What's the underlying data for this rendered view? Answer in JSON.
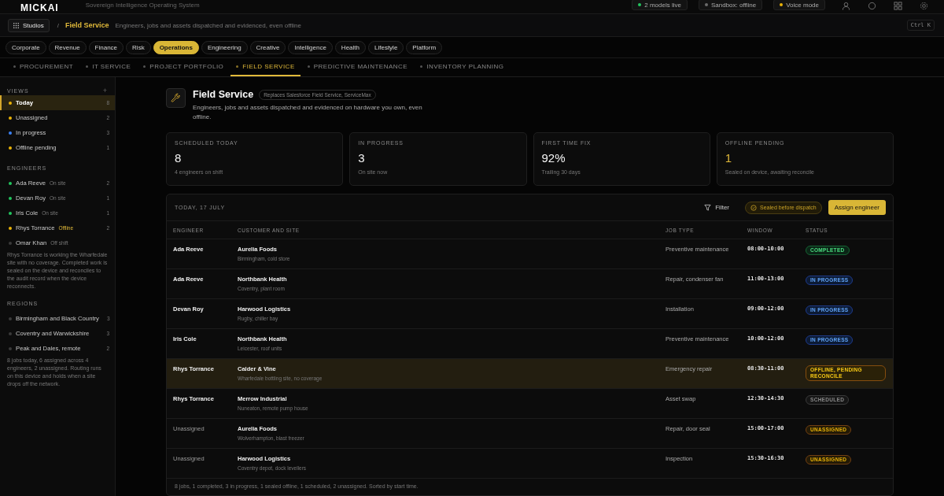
{
  "top_bar": {
    "logo": "MICKAI",
    "tagline": "Sovereign Intelligence Operating System",
    "pills": [
      {
        "label": "2 models live",
        "color": "#22c55e"
      },
      {
        "label": "Sandbox: offline",
        "color": "#6b6b6b"
      },
      {
        "label": "Voice mode",
        "color": "#eab308"
      }
    ]
  },
  "breadcrumb": {
    "studios": "Studios",
    "separator": "/",
    "current": "Field Service",
    "description": "Engineers, jobs and assets dispatched and evidenced, even offline",
    "shortcut": "Ctrl K"
  },
  "studios": [
    {
      "label": "Corporate",
      "selected": false
    },
    {
      "label": "Revenue",
      "selected": false
    },
    {
      "label": "Finance",
      "selected": false
    },
    {
      "label": "Risk",
      "selected": false
    },
    {
      "label": "Operations",
      "selected": true
    },
    {
      "label": "Engineering",
      "selected": false
    },
    {
      "label": "Creative",
      "selected": false
    },
    {
      "label": "Intelligence",
      "selected": false
    },
    {
      "label": "Health",
      "selected": false
    },
    {
      "label": "Lifestyle",
      "selected": false
    },
    {
      "label": "Platform",
      "selected": false
    }
  ],
  "tabs": [
    {
      "label": "PROCUREMENT",
      "selected": false
    },
    {
      "label": "IT SERVICE",
      "selected": false
    },
    {
      "label": "PROJECT PORTFOLIO",
      "selected": false
    },
    {
      "label": "FIELD SERVICE",
      "selected": true
    },
    {
      "label": "PREDICTIVE MAINTENANCE",
      "selected": false
    },
    {
      "label": "INVENTORY PLANNING",
      "selected": false
    }
  ],
  "sidebar": {
    "views_title": "VIEWS",
    "add": "+",
    "views": [
      {
        "label": "Today",
        "count": "8",
        "color": "#eab308",
        "selected": true
      },
      {
        "label": "Unassigned",
        "count": "2",
        "color": "#eab308",
        "selected": false
      },
      {
        "label": "In progress",
        "count": "3",
        "color": "#3b82f6",
        "selected": false
      },
      {
        "label": "Offline pending",
        "count": "1",
        "color": "#eab308",
        "selected": false
      }
    ],
    "engineers_title": "ENGINEERS",
    "engineers": [
      {
        "name": "Ada Reeve",
        "status": "On site",
        "count": "2",
        "color": "#22c55e",
        "offline": false
      },
      {
        "name": "Devan Roy",
        "status": "On site",
        "count": "1",
        "color": "#22c55e",
        "offline": false
      },
      {
        "name": "Iris Cole",
        "status": "On site",
        "count": "1",
        "color": "#22c55e",
        "offline": false
      },
      {
        "name": "Rhys Torrance",
        "status": "Offline",
        "count": "2",
        "color": "#eab308",
        "offline": true
      },
      {
        "name": "Omar Khan",
        "status": "Off shift",
        "color": "#3a3a3a",
        "offline": false
      }
    ],
    "engineers_note": "Rhys Torrance is working the Wharfedale site with no coverage. Completed work is sealed on the device and reconciles to the audit record when the device reconnects.",
    "regions_title": "REGIONS",
    "regions": [
      {
        "label": "Birmingham and Black Country",
        "count": "3"
      },
      {
        "label": "Coventry and Warwickshire",
        "count": "3"
      },
      {
        "label": "Peak and Dales, remote",
        "count": "2"
      }
    ],
    "regions_note": "8 jobs today, 6 assigned across 4 engineers, 2 unassigned. Routing runs on this device and holds when a site drops off the network."
  },
  "header": {
    "title": "Field Service",
    "badge": "Replaces Salesforce Field Service, ServiceMax",
    "description": "Engineers, jobs and assets dispatched and evidenced on hardware you own, even offline."
  },
  "stats": [
    {
      "label": "SCHEDULED TODAY",
      "value": "8",
      "note": "4 engineers on shift",
      "highlight": false
    },
    {
      "label": "IN PROGRESS",
      "value": "3",
      "note": "On site now",
      "highlight": false
    },
    {
      "label": "FIRST TIME FIX",
      "value": "92%",
      "note": "Trailing 30 days",
      "highlight": false
    },
    {
      "label": "OFFLINE PENDING",
      "value": "1",
      "note": "Sealed on device, awaiting reconcile",
      "highlight": true
    }
  ],
  "table": {
    "title": "TODAY, 17 JULY",
    "filter": "Filter",
    "sealed_badge": "Sealed before dispatch",
    "assign_button": "Assign engineer",
    "columns": [
      "ENGINEER",
      "CUSTOMER AND SITE",
      "JOB TYPE",
      "WINDOW",
      "STATUS"
    ],
    "rows": [
      {
        "engineer": "Ada Reeve",
        "assigned": true,
        "customer": "Aurelia Foods",
        "site": "Birmingham, cold store",
        "job_type": "Preventive maintenance",
        "window": "08:00-10:00",
        "status": "COMPLETED",
        "kind": "completed",
        "selected": false
      },
      {
        "engineer": "Ada Reeve",
        "assigned": true,
        "customer": "Northbank Health",
        "site": "Coventry, plant room",
        "job_type": "Repair, condenser fan",
        "window": "11:00-13:00",
        "status": "IN PROGRESS",
        "kind": "progress",
        "selected": false
      },
      {
        "engineer": "Devan Roy",
        "assigned": true,
        "customer": "Harwood Logistics",
        "site": "Rugby, chiller bay",
        "job_type": "Installation",
        "window": "09:00-12:00",
        "status": "IN PROGRESS",
        "kind": "progress",
        "selected": false
      },
      {
        "engineer": "Iris Cole",
        "assigned": true,
        "customer": "Northbank Health",
        "site": "Leicester, roof units",
        "job_type": "Preventive maintenance",
        "window": "10:00-12:00",
        "status": "IN PROGRESS",
        "kind": "progress",
        "selected": false
      },
      {
        "engineer": "Rhys Torrance",
        "assigned": true,
        "customer": "Calder & Vine",
        "site": "Wharfedale bottling site, no coverage",
        "job_type": "Emergency repair",
        "window": "08:30-11:00",
        "status": "OFFLINE, PENDING RECONCILE",
        "kind": "offline",
        "selected": true
      },
      {
        "engineer": "Rhys Torrance",
        "assigned": true,
        "customer": "Merrow Industrial",
        "site": "Nuneaton, remote pump house",
        "job_type": "Asset swap",
        "window": "12:30-14:30",
        "status": "SCHEDULED",
        "kind": "scheduled",
        "selected": false
      },
      {
        "engineer": "Unassigned",
        "assigned": false,
        "customer": "Aurelia Foods",
        "site": "Wolverhampton, blast freezer",
        "job_type": "Repair, door seal",
        "window": "15:00-17:00",
        "status": "UNASSIGNED",
        "kind": "unassigned",
        "selected": false
      },
      {
        "engineer": "Unassigned",
        "assigned": false,
        "customer": "Harwood Logistics",
        "site": "Coventry depot, dock levellers",
        "job_type": "Inspection",
        "window": "15:30-16:30",
        "status": "UNASSIGNED",
        "kind": "unassigned",
        "selected": false
      }
    ],
    "footer": "8 jobs, 1 completed, 3 in progress, 1 sealed offline, 1 scheduled, 2 unassigned. Sorted by start time."
  }
}
